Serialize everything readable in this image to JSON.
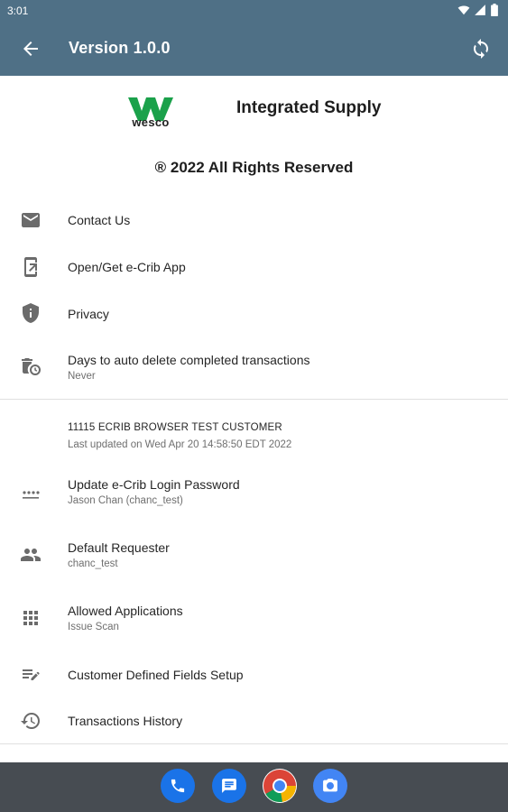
{
  "status_bar": {
    "time": "3:01",
    "icons": [
      "wifi-icon",
      "signal-icon",
      "battery-icon"
    ]
  },
  "app_bar": {
    "title": "Version 1.0.0",
    "back_icon": "arrow-back-icon",
    "sync_icon": "sync-icon",
    "color": "#4f7086"
  },
  "brand": {
    "logo_word": "wesco",
    "name": "Integrated Supply",
    "copyright": "® 2022 All Rights Reserved",
    "logo_color": "#1ba14b"
  },
  "menu_top": [
    {
      "icon": "mail-icon",
      "label": "Contact Us"
    },
    {
      "icon": "app-launch-icon",
      "label": "Open/Get e-Crib App"
    },
    {
      "icon": "shield-icon",
      "label": "Privacy"
    },
    {
      "icon": "delete-clock-icon",
      "label": "Days to auto delete completed transactions",
      "sub": "Never"
    }
  ],
  "account": {
    "customer": "11115 ECRIB BROWSER TEST CUSTOMER",
    "last_updated": "Last updated on Wed Apr 20 14:58:50 EDT 2022"
  },
  "menu_bottom": [
    {
      "icon": "password-icon",
      "label": "Update e-Crib Login Password",
      "sub": "Jason Chan (chanc_test)"
    },
    {
      "icon": "people-icon",
      "label": "Default Requester",
      "sub": "chanc_test"
    },
    {
      "icon": "apps-grid-icon",
      "label": "Allowed Applications",
      "sub": "Issue Scan"
    },
    {
      "icon": "edit-list-icon",
      "label": "Customer Defined Fields Setup"
    },
    {
      "icon": "history-icon",
      "label": "Transactions History"
    }
  ],
  "dock": [
    "phone-icon",
    "messages-icon",
    "chrome-icon",
    "camera-icon"
  ]
}
